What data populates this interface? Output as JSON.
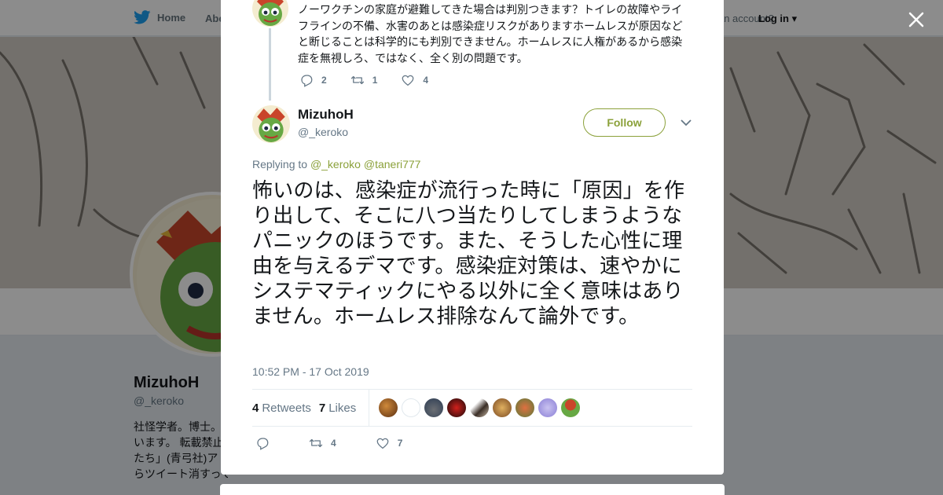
{
  "nav": {
    "home_label": "Home",
    "about_label": "About",
    "account_prompt": "Have an account?",
    "login_label": "Log in"
  },
  "profile": {
    "name": "MizuhoH",
    "handle": "@_keroko",
    "bio_lines": [
      "社怪学者。博士。",
      "います。 転載禁止",
      "たち」(青弓社)ア",
      "らツイート消すっては。"
    ]
  },
  "parent_tweet": {
    "text": "ノーワクチンの家庭が避難してきた場合は判別つきます？トイレの故障やライフラインの不備、水害のあとは感染症リスクがありますホームレスが原因などと断じることは科学的にも判別できません。ホームレスに人権があるから感染症を無視しろ、ではなく、全く別の問題です。",
    "replies": "2",
    "retweets": "1",
    "likes": "4"
  },
  "tweet": {
    "author_name": "MizuhoH",
    "author_handle": "@_keroko",
    "follow_label": "Follow",
    "replying_prefix": "Replying to",
    "replying_to_1": "@_keroko",
    "replying_to_2": "@taneri777",
    "text": "怖いのは、感染症が流行った時に「原因」を作り出して、そこに八つ当たりしてしまうようなパニックのほうです。また、そうした心性に理由を与えるデマです。感染症対策は、速やかにシステマティックにやる以外に全く意味はありません。ホームレス排除なんて論外です。",
    "timestamp": "10:52 PM - 17 Oct 2019",
    "retweets_count": "4",
    "retweets_label": "Retweets",
    "likes_count": "7",
    "likes_label": "Likes",
    "action_retweets": "4",
    "action_likes": "7"
  },
  "colors": {
    "accent": "#8ba13a",
    "secondary_text": "#657786",
    "twitter_blue": "#1da1f2"
  },
  "icons": [
    "twitter-bird-icon",
    "close-icon",
    "reply-icon",
    "retweet-icon",
    "heart-icon",
    "chevron-down-icon"
  ]
}
